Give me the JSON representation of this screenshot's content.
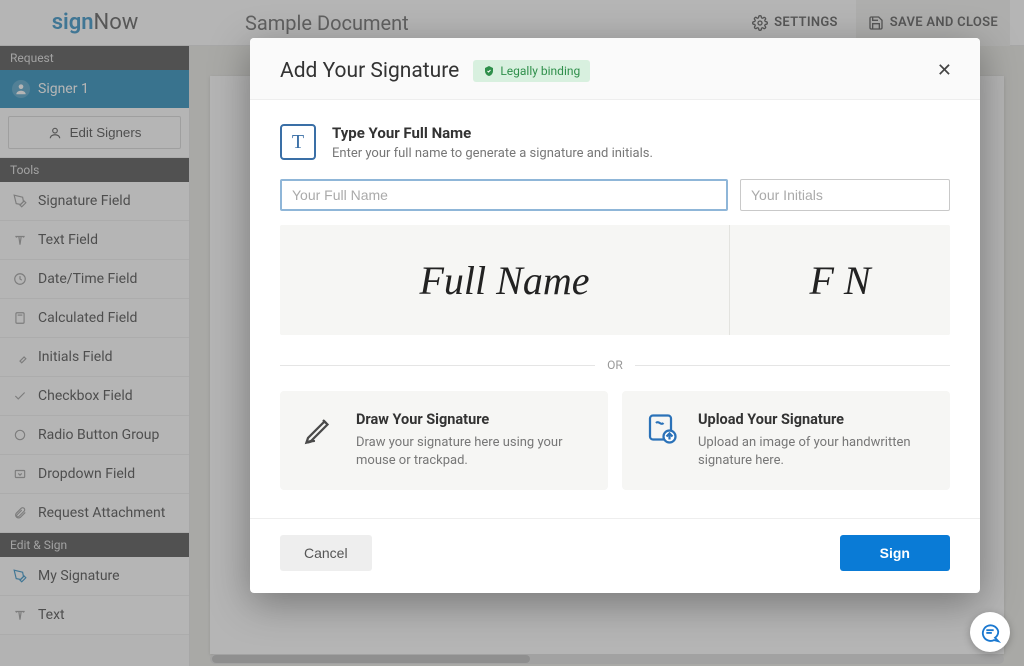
{
  "brand": {
    "part1": "sign",
    "part2": "Now"
  },
  "document_title": "Sample Document",
  "top_actions": {
    "settings": "SETTINGS",
    "save_close": "SAVE AND CLOSE"
  },
  "sidebar": {
    "sections": {
      "request": "Request",
      "tools": "Tools",
      "edit_sign": "Edit & Sign"
    },
    "signer": "Signer 1",
    "edit_signers": "Edit Signers",
    "tools": [
      {
        "label": "Signature Field"
      },
      {
        "label": "Text Field"
      },
      {
        "label": "Date/Time Field"
      },
      {
        "label": "Calculated Field"
      },
      {
        "label": "Initials Field"
      },
      {
        "label": "Checkbox Field"
      },
      {
        "label": "Radio Button Group"
      },
      {
        "label": "Dropdown Field"
      },
      {
        "label": "Request Attachment"
      }
    ],
    "editsign": [
      {
        "label": "My Signature"
      },
      {
        "label": "Text"
      }
    ]
  },
  "modal": {
    "title": "Add Your Signature",
    "badge": "Legally binding",
    "type_section": {
      "heading": "Type Your Full Name",
      "subtext": "Enter your full name to generate a signature and initials.",
      "name_placeholder": "Your Full Name",
      "initials_placeholder": "Your Initials",
      "preview_name": "Full Name",
      "preview_initials": "F N"
    },
    "divider": "OR",
    "draw": {
      "heading": "Draw Your Signature",
      "text": "Draw your signature here using your mouse or trackpad."
    },
    "upload": {
      "heading": "Upload Your Signature",
      "text": "Upload an image of your handwritten signature here."
    },
    "cancel": "Cancel",
    "sign": "Sign"
  }
}
